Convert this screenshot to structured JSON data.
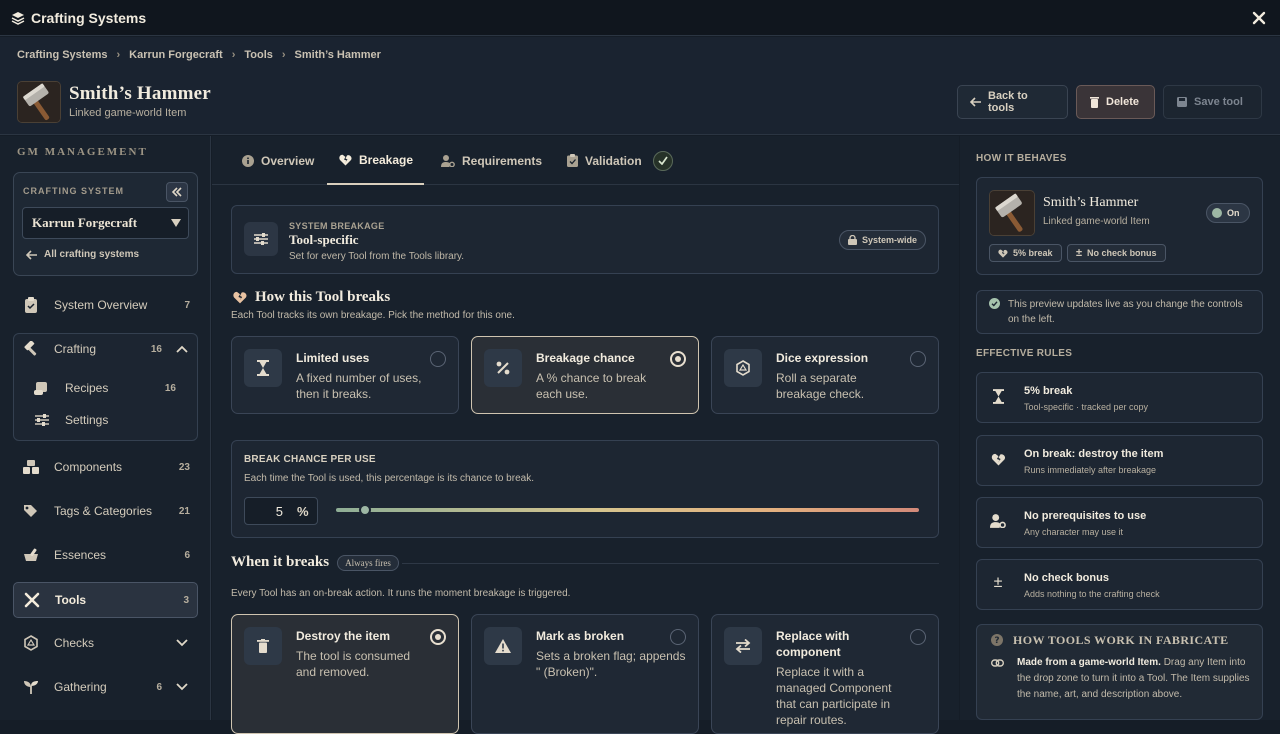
{
  "window": {
    "title": "Crafting Systems"
  },
  "breadcrumb": [
    "Crafting Systems",
    "Karrun Forgecraft",
    "Tools",
    "Smith’s Hammer"
  ],
  "item": {
    "name": "Smith’s Hammer",
    "subtitle": "Linked game-world Item"
  },
  "header_buttons": {
    "back": "Back to tools",
    "delete": "Delete",
    "save": "Save tool"
  },
  "sidebar": {
    "section": "GM MANAGEMENT",
    "crafting_system_label": "CRAFTING SYSTEM",
    "crafting_system_value": "Karrun Forgecraft",
    "all_systems": "All crafting systems",
    "items": [
      {
        "label": "System Overview",
        "count": "7",
        "icon": "clipboard-icon"
      },
      {
        "label": "Crafting",
        "count": "16",
        "icon": "hammer-icon"
      },
      {
        "label": "Recipes",
        "count": "16",
        "icon": "scroll-icon"
      },
      {
        "label": "Settings",
        "count": "",
        "icon": "sliders-icon"
      },
      {
        "label": "Components",
        "count": "23",
        "icon": "boxes-icon"
      },
      {
        "label": "Tags & Categories",
        "count": "21",
        "icon": "tags-icon"
      },
      {
        "label": "Essences",
        "count": "6",
        "icon": "mortar-icon"
      },
      {
        "label": "Tools",
        "count": "3",
        "icon": "tools-icon"
      },
      {
        "label": "Checks",
        "count": "",
        "icon": "d20-icon"
      },
      {
        "label": "Gathering",
        "count": "6",
        "icon": "sprout-icon"
      }
    ]
  },
  "tabs": [
    {
      "label": "Overview",
      "icon": "info-icon"
    },
    {
      "label": "Breakage",
      "icon": "heart-broken-icon"
    },
    {
      "label": "Requirements",
      "icon": "user-gear-icon"
    },
    {
      "label": "Validation",
      "icon": "clipboard-check-icon"
    }
  ],
  "system_breakage": {
    "eyebrow": "SYSTEM BREAKAGE",
    "title": "Tool-specific",
    "desc": "Set for every Tool from the Tools library.",
    "chip": "System-wide"
  },
  "how_breaks": {
    "title": "How this Tool breaks",
    "desc": "Each Tool tracks its own breakage. Pick the method for this one.",
    "options": [
      {
        "title": "Limited uses",
        "desc": "A fixed number of uses, then it breaks.",
        "icon": "hourglass-icon",
        "selected": false
      },
      {
        "title": "Breakage chance",
        "desc": "A % chance to break each use.",
        "icon": "percent-icon",
        "selected": true
      },
      {
        "title": "Dice expression",
        "desc": "Roll a separate breakage check.",
        "icon": "d20-icon",
        "selected": false
      }
    ]
  },
  "break_chance": {
    "label": "BREAK CHANCE PER USE",
    "desc": "Each time the Tool is used, this percentage is its chance to break.",
    "value": "5",
    "unit": "%",
    "slider_fraction": 0.05
  },
  "when_breaks": {
    "title": "When it breaks",
    "badge": "Always fires",
    "desc": "Every Tool has an on-break action. It runs the moment breakage is triggered.",
    "options": [
      {
        "title": "Destroy the item",
        "desc": "The tool is consumed and removed.",
        "icon": "trash-icon",
        "selected": true
      },
      {
        "title": "Mark as broken",
        "desc": "Sets a broken flag; appends \" (Broken)\".",
        "icon": "warning-icon",
        "selected": false
      },
      {
        "title": "Replace with component",
        "desc": "Replace it with a managed Component that can participate in repair routes.",
        "icon": "swap-icon",
        "selected": false
      }
    ]
  },
  "preview": {
    "heading": "HOW IT BEHAVES",
    "name": "Smith’s Hammer",
    "subtitle": "Linked game-world Item",
    "toggle": "On",
    "chips": [
      "5% break",
      "No check bonus"
    ],
    "note": "This preview updates live as you change the controls on the left."
  },
  "effective_rules": {
    "heading": "EFFECTIVE RULES",
    "rules": [
      {
        "title": "5% break",
        "desc": "Tool-specific · tracked per copy",
        "icon": "hourglass-icon"
      },
      {
        "title": "On break: destroy the item",
        "desc": "Runs immediately after breakage",
        "icon": "heart-broken-icon"
      },
      {
        "title": "No prerequisites to use",
        "desc": "Any character may use it",
        "icon": "user-gear-icon"
      },
      {
        "title": "No check bonus",
        "desc": "Adds nothing to the crafting check",
        "icon": "plus-minus-icon"
      }
    ]
  },
  "how_tools_work": {
    "title": "HOW TOOLS WORK IN FABRICATE",
    "lead": "Made from a game-world Item.",
    "body": "Drag any Item into the drop zone to turn it into a Tool. The Item supplies the name, art, and description above."
  }
}
